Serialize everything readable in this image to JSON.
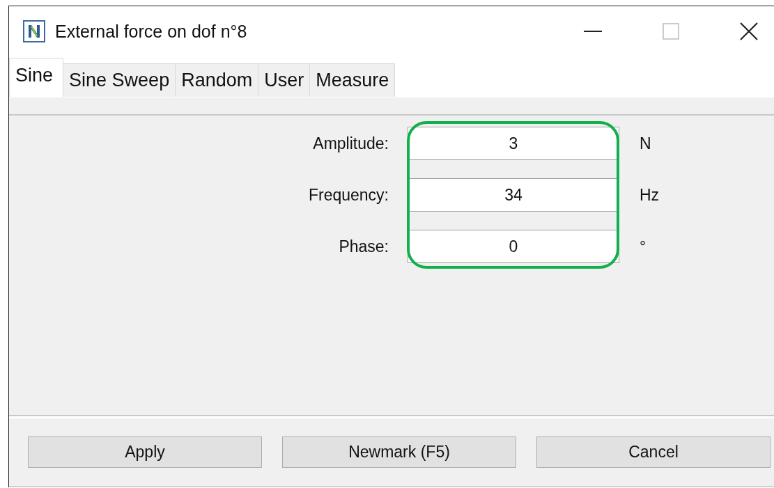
{
  "window": {
    "title": "External force on dof n°8"
  },
  "tabs": [
    {
      "label": "Sine",
      "selected": true
    },
    {
      "label": "Sine Sweep",
      "selected": false
    },
    {
      "label": "Random",
      "selected": false
    },
    {
      "label": "User",
      "selected": false
    },
    {
      "label": "Measure",
      "selected": false
    }
  ],
  "fields": [
    {
      "label": "Amplitude:",
      "value": "3",
      "unit": "N"
    },
    {
      "label": "Frequency:",
      "value": "34",
      "unit": "Hz"
    },
    {
      "label": "Phase:",
      "value": "0",
      "unit": "°"
    }
  ],
  "buttons": [
    "Apply",
    "Newmark (F5)",
    "Cancel"
  ]
}
